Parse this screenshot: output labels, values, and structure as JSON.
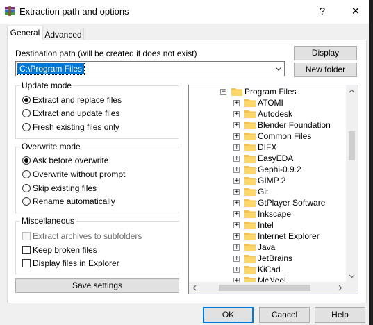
{
  "window": {
    "title": "Extraction path and options",
    "help": "?",
    "close": "✕"
  },
  "tabs": [
    {
      "label": "General",
      "active": true
    },
    {
      "label": "Advanced",
      "active": false
    }
  ],
  "destination": {
    "label": "Destination path (will be created if does not exist)",
    "value": "C:\\Program Files"
  },
  "buttons": {
    "display": "Display",
    "new_folder": "New folder",
    "save_settings": "Save settings"
  },
  "update_mode": {
    "title": "Update mode",
    "options": [
      {
        "label": "Extract and replace files",
        "checked": true
      },
      {
        "label": "Extract and update files",
        "checked": false
      },
      {
        "label": "Fresh existing files only",
        "checked": false
      }
    ]
  },
  "overwrite_mode": {
    "title": "Overwrite mode",
    "options": [
      {
        "label": "Ask before overwrite",
        "checked": true
      },
      {
        "label": "Overwrite without prompt",
        "checked": false
      },
      {
        "label": "Skip existing files",
        "checked": false
      },
      {
        "label": "Rename automatically",
        "checked": false
      }
    ]
  },
  "miscellaneous": {
    "title": "Miscellaneous",
    "options": [
      {
        "label": "Extract archives to subfolders",
        "checked": false,
        "disabled": true
      },
      {
        "label": "Keep broken files",
        "checked": false,
        "disabled": false
      },
      {
        "label": "Display files in Explorer",
        "checked": false,
        "disabled": false
      }
    ]
  },
  "tree": {
    "root": "Program Files",
    "items": [
      "ATOMI",
      "Autodesk",
      "Blender Foundation",
      "Common Files",
      "DIFX",
      "EasyEDA",
      "Gephi-0.9.2",
      "GIMP 2",
      "Git",
      "GtPlayer Software",
      "Inkscape",
      "Intel",
      "Internet Explorer",
      "Java",
      "JetBrains",
      "KiCad",
      "McNeel"
    ]
  },
  "footer": {
    "ok": "OK",
    "cancel": "Cancel",
    "help": "Help"
  },
  "colors": {
    "accent": "#0078d7",
    "folder": "#f4c34e"
  }
}
